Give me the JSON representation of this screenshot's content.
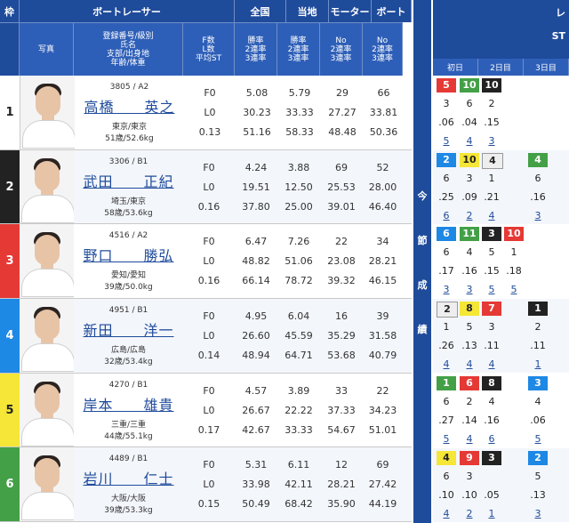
{
  "header": {
    "racer_group": "ボートレーサー",
    "zenkoku": "全国",
    "tochi": "当地",
    "motor": "モーター",
    "boat": "ボート",
    "waku": "枠",
    "photo": "写真",
    "info_lines": [
      "登録番号/級別",
      "氏名",
      "支部/出身地",
      "年齢/体重"
    ],
    "st_lines": [
      "F数",
      "L数",
      "平均ST"
    ],
    "zenkoku_lines": [
      "勝率",
      "2連率",
      "3連率"
    ],
    "tochi_lines": [
      "勝率",
      "2連率",
      "3連率"
    ],
    "motor_lines": [
      "No",
      "2連率",
      "3連率"
    ],
    "boat_lines": [
      "No",
      "2連率",
      "3連率"
    ]
  },
  "right": {
    "title": "レ",
    "subtitle": "ST",
    "days": [
      "初日",
      "2日目",
      "3日目"
    ],
    "konsetsu": [
      "今",
      "節",
      "成",
      "績"
    ]
  },
  "colors": {
    "frame1": "#ffffff",
    "frame2": "#222222",
    "frame3": "#e53935",
    "frame4": "#1e88e5",
    "frame5": "#f5e637",
    "frame6": "#43a047",
    "header": "#1f4b9b"
  },
  "racers": [
    {
      "frame": "1",
      "reg": "3805 / A2",
      "name": "高橋　　英之",
      "branch": "東京/東京",
      "age": "51歳/52.6kg",
      "f": "F0",
      "l": "L0",
      "st": "0.13",
      "z_win": "5.08",
      "z_2": "30.23",
      "z_3": "51.16",
      "t_win": "5.79",
      "t_2": "33.33",
      "t_3": "58.33",
      "m_no": "29",
      "m_2": "27.27",
      "m_3": "48.48",
      "b_no": "66",
      "b_2": "33.81",
      "b_3": "50.36"
    },
    {
      "frame": "2",
      "reg": "3306 / B1",
      "name": "武田　　正紀",
      "branch": "埼玉/東京",
      "age": "58歳/53.6kg",
      "f": "F0",
      "l": "L0",
      "st": "0.16",
      "z_win": "4.24",
      "z_2": "19.51",
      "z_3": "37.80",
      "t_win": "3.88",
      "t_2": "12.50",
      "t_3": "25.00",
      "m_no": "69",
      "m_2": "25.53",
      "m_3": "39.01",
      "b_no": "52",
      "b_2": "28.00",
      "b_3": "46.40"
    },
    {
      "frame": "3",
      "reg": "4516 / A2",
      "name": "野口　　勝弘",
      "branch": "愛知/愛知",
      "age": "39歳/50.0kg",
      "f": "F0",
      "l": "L0",
      "st": "0.16",
      "z_win": "6.47",
      "z_2": "48.82",
      "z_3": "66.14",
      "t_win": "7.26",
      "t_2": "51.06",
      "t_3": "78.72",
      "m_no": "22",
      "m_2": "23.08",
      "m_3": "39.32",
      "b_no": "34",
      "b_2": "28.21",
      "b_3": "46.15"
    },
    {
      "frame": "4",
      "reg": "4951 / B1",
      "name": "新田　　洋一",
      "branch": "広島/広島",
      "age": "32歳/53.4kg",
      "f": "F0",
      "l": "L0",
      "st": "0.14",
      "z_win": "4.95",
      "z_2": "26.60",
      "z_3": "48.94",
      "t_win": "6.04",
      "t_2": "45.59",
      "t_3": "64.71",
      "m_no": "16",
      "m_2": "35.29",
      "m_3": "53.68",
      "b_no": "39",
      "b_2": "31.58",
      "b_3": "40.79"
    },
    {
      "frame": "5",
      "reg": "4270 / B1",
      "name": "岸本　　雄貴",
      "branch": "三重/三重",
      "age": "44歳/55.1kg",
      "f": "F0",
      "l": "L0",
      "st": "0.17",
      "z_win": "4.57",
      "z_2": "26.67",
      "z_3": "42.67",
      "t_win": "3.89",
      "t_2": "22.22",
      "t_3": "33.33",
      "m_no": "33",
      "m_2": "37.33",
      "m_3": "54.67",
      "b_no": "22",
      "b_2": "34.23",
      "b_3": "51.01"
    },
    {
      "frame": "6",
      "reg": "4489 / B1",
      "name": "岩川　　仁士",
      "branch": "大阪/大阪",
      "age": "39歳/53.3kg",
      "f": "F0",
      "l": "L0",
      "st": "0.15",
      "z_win": "5.31",
      "z_2": "33.98",
      "z_3": "50.49",
      "t_win": "6.11",
      "t_2": "42.11",
      "t_3": "68.42",
      "m_no": "12",
      "m_2": "28.21",
      "m_3": "35.90",
      "b_no": "69",
      "b_2": "27.42",
      "b_3": "44.19"
    }
  ],
  "results": [
    {
      "boxes": [
        {
          "v": "5",
          "c": "fc5r"
        },
        {
          "v": "10",
          "c": "fc6"
        },
        {
          "v": "10",
          "c": "fc2"
        }
      ],
      "lane": [
        "3",
        "6",
        "2",
        ""
      ],
      "st": [
        ".06",
        ".04",
        ".15",
        ""
      ],
      "rank": [
        "5",
        "4",
        "3",
        ""
      ]
    },
    {
      "boxes": [
        {
          "v": "2",
          "c": "fc4"
        },
        {
          "v": "10",
          "c": "fc5"
        },
        {
          "v": "4",
          "c": "fc1g"
        },
        {
          "v": "",
          "c": ""
        },
        {
          "v": "4",
          "c": "fc6"
        }
      ],
      "lane": [
        "6",
        "3",
        "1",
        "",
        "6"
      ],
      "st": [
        ".25",
        ".09",
        ".21",
        "",
        ".16"
      ],
      "rank": [
        "6",
        "2",
        "4",
        "",
        "3"
      ]
    },
    {
      "boxes": [
        {
          "v": "6",
          "c": "fc4"
        },
        {
          "v": "11",
          "c": "fc6"
        },
        {
          "v": "3",
          "c": "fc2"
        },
        {
          "v": "10",
          "c": "fc3"
        }
      ],
      "lane": [
        "6",
        "4",
        "5",
        "1"
      ],
      "st": [
        ".17",
        ".16",
        ".15",
        ".18"
      ],
      "rank": [
        "3",
        "3",
        "5",
        "5"
      ]
    },
    {
      "boxes": [
        {
          "v": "2",
          "c": "fc1g"
        },
        {
          "v": "8",
          "c": "fc5"
        },
        {
          "v": "7",
          "c": "fc3"
        },
        {
          "v": "",
          "c": ""
        },
        {
          "v": "1",
          "c": "fc2"
        }
      ],
      "lane": [
        "1",
        "5",
        "3",
        "",
        "2"
      ],
      "st": [
        ".26",
        ".13",
        ".11",
        "",
        ".11"
      ],
      "rank": [
        "4",
        "4",
        "4",
        "",
        "1"
      ]
    },
    {
      "boxes": [
        {
          "v": "1",
          "c": "fc6"
        },
        {
          "v": "6",
          "c": "fc3"
        },
        {
          "v": "8",
          "c": "fc2"
        },
        {
          "v": "",
          "c": ""
        },
        {
          "v": "3",
          "c": "fc4"
        }
      ],
      "lane": [
        "6",
        "2",
        "4",
        "",
        "4"
      ],
      "st": [
        ".27",
        ".14",
        ".16",
        "",
        ".06"
      ],
      "rank": [
        "5",
        "4",
        "6",
        "",
        "5"
      ]
    },
    {
      "boxes": [
        {
          "v": "4",
          "c": "fc5"
        },
        {
          "v": "9",
          "c": "fc3"
        },
        {
          "v": "3",
          "c": "fc2"
        },
        {
          "v": "",
          "c": ""
        },
        {
          "v": "2",
          "c": "fc4"
        }
      ],
      "lane": [
        "6",
        "3",
        "",
        "",
        "5"
      ],
      "st": [
        ".10",
        ".10",
        ".05",
        "",
        ".13"
      ],
      "rank": [
        "4",
        "2",
        "1",
        "",
        "3"
      ]
    }
  ]
}
